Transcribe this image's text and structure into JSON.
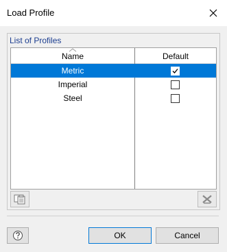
{
  "window": {
    "title": "Load Profile"
  },
  "group": {
    "title": "List of Profiles"
  },
  "grid": {
    "columns": {
      "name": "Name",
      "default": "Default"
    },
    "rows": [
      {
        "name": "Metric",
        "default": true,
        "selected": true
      },
      {
        "name": "Imperial",
        "default": false,
        "selected": false
      },
      {
        "name": "Steel",
        "default": false,
        "selected": false
      }
    ]
  },
  "toolbar": {
    "copy_icon": "copy-to-clipboard-icon",
    "delete_icon": "delete-icon"
  },
  "buttons": {
    "help_icon": "help-icon",
    "ok": "OK",
    "cancel": "Cancel"
  },
  "colors": {
    "selection": "#0078d7",
    "group_title": "#1a3c8f"
  }
}
